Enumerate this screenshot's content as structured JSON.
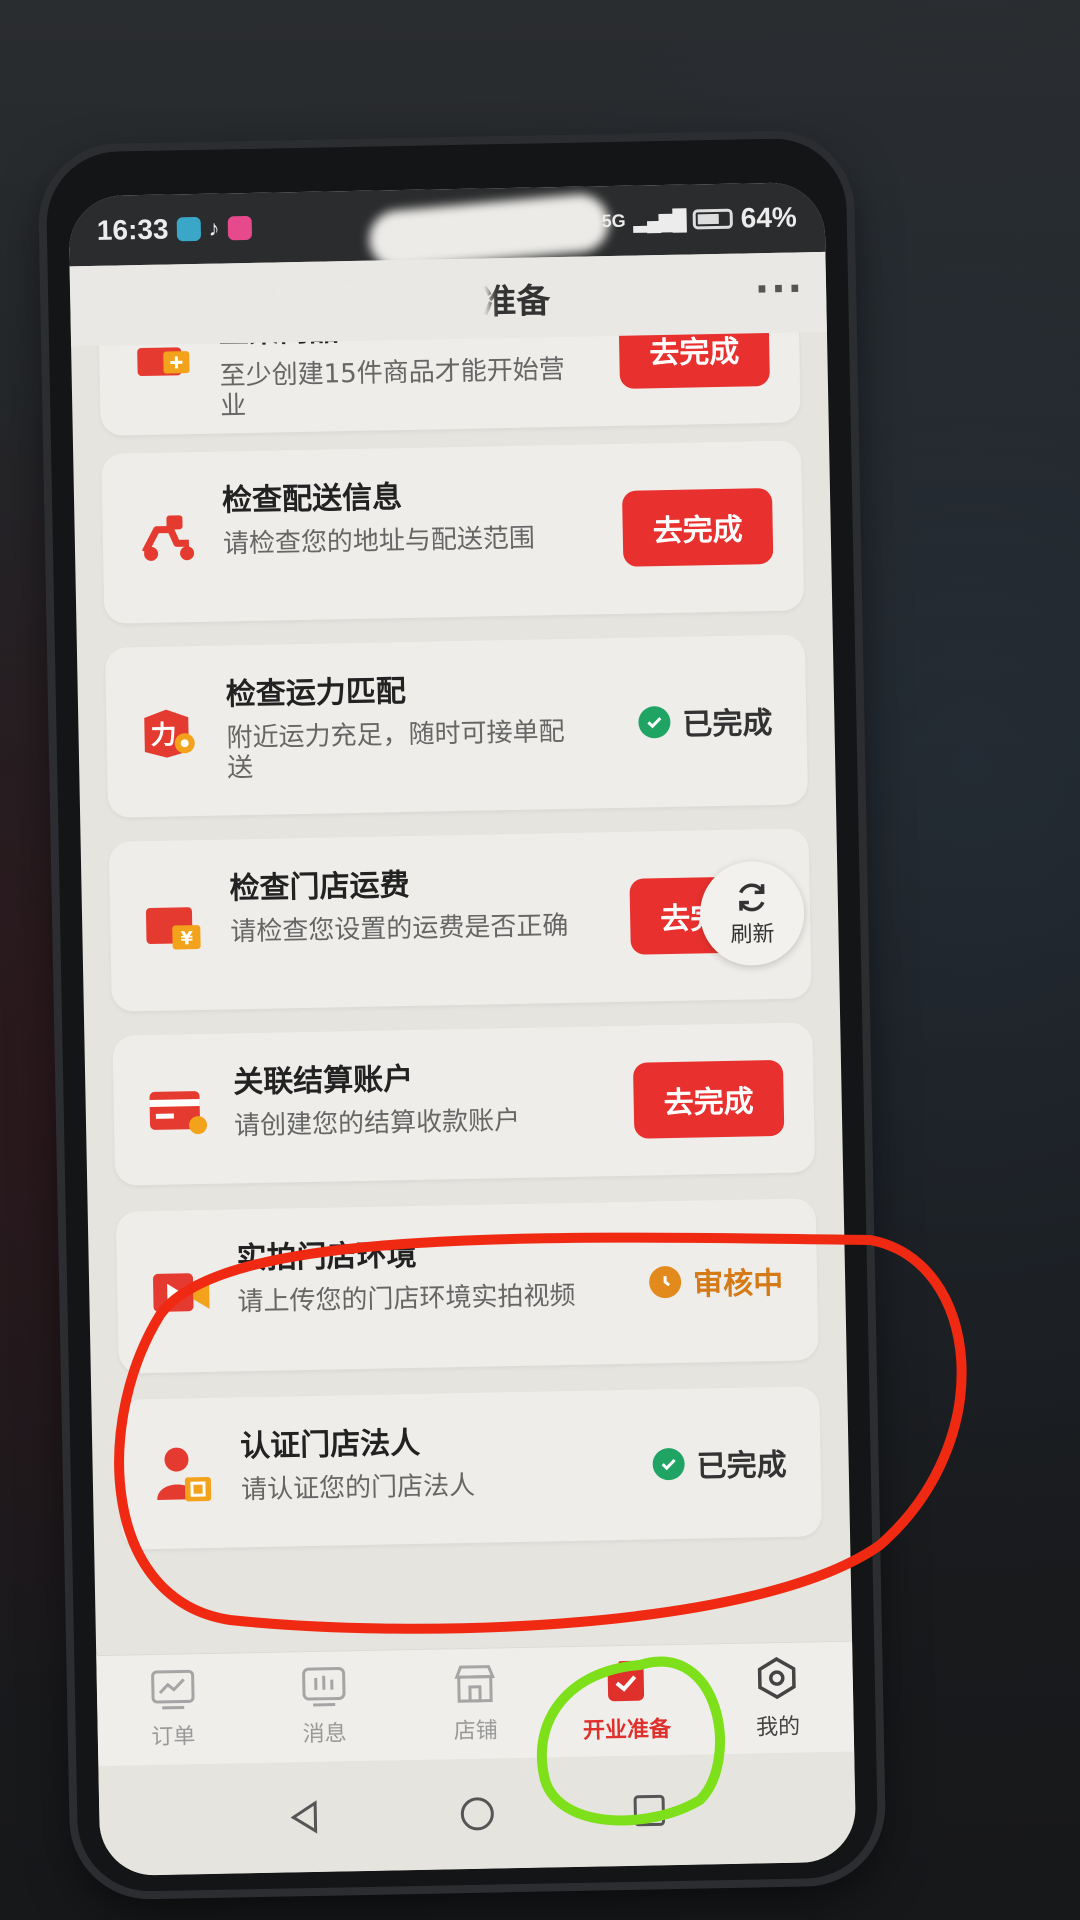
{
  "status_bar": {
    "time": "16:33",
    "network": "5G",
    "battery": "64%"
  },
  "header": {
    "title": "新店开业准备",
    "more": "···"
  },
  "tasks": [
    {
      "title": "上架商品",
      "desc": "至少创建15件商品才能开始营业",
      "button": "去完成",
      "state": "todo",
      "icon": "product-icon"
    },
    {
      "title": "检查配送信息",
      "desc": "请检查您的地址与配送范围",
      "button": "去完成",
      "state": "todo",
      "icon": "scooter-icon"
    },
    {
      "title": "检查运力匹配",
      "desc": "附近运力充足，随时可接单配送",
      "status": "已完成",
      "state": "done",
      "icon": "delivery-capacity-icon"
    },
    {
      "title": "检查门店运费",
      "desc": "请检查您设置的运费是否正确",
      "button": "去完成",
      "state": "todo",
      "icon": "shipping-fee-icon"
    },
    {
      "title": "关联结算账户",
      "desc": "请创建您的结算收款账户",
      "button": "去完成",
      "state": "todo",
      "icon": "bank-card-icon"
    },
    {
      "title": "实拍门店环境",
      "desc": "请上传您的门店环境实拍视频",
      "status": "审核中",
      "state": "review",
      "icon": "video-camera-icon"
    },
    {
      "title": "认证门店法人",
      "desc": "请认证您的门店法人",
      "status": "已完成",
      "state": "done",
      "icon": "legal-person-icon"
    }
  ],
  "refresh": {
    "label": "刷新"
  },
  "tabs": [
    {
      "label": "订单",
      "icon": "chart-icon",
      "active": false
    },
    {
      "label": "消息",
      "icon": "message-icon",
      "active": false
    },
    {
      "label": "店铺",
      "icon": "store-icon",
      "active": false
    },
    {
      "label": "开业准备",
      "icon": "clipboard-check-icon",
      "active": true
    },
    {
      "label": "我的",
      "icon": "hexagon-settings-icon",
      "active": false
    }
  ],
  "colors": {
    "accent": "#e8312e",
    "done": "#1fa463",
    "review": "#e28a1c",
    "annotation_red": "#f02a12",
    "annotation_green": "#7ee01a"
  }
}
